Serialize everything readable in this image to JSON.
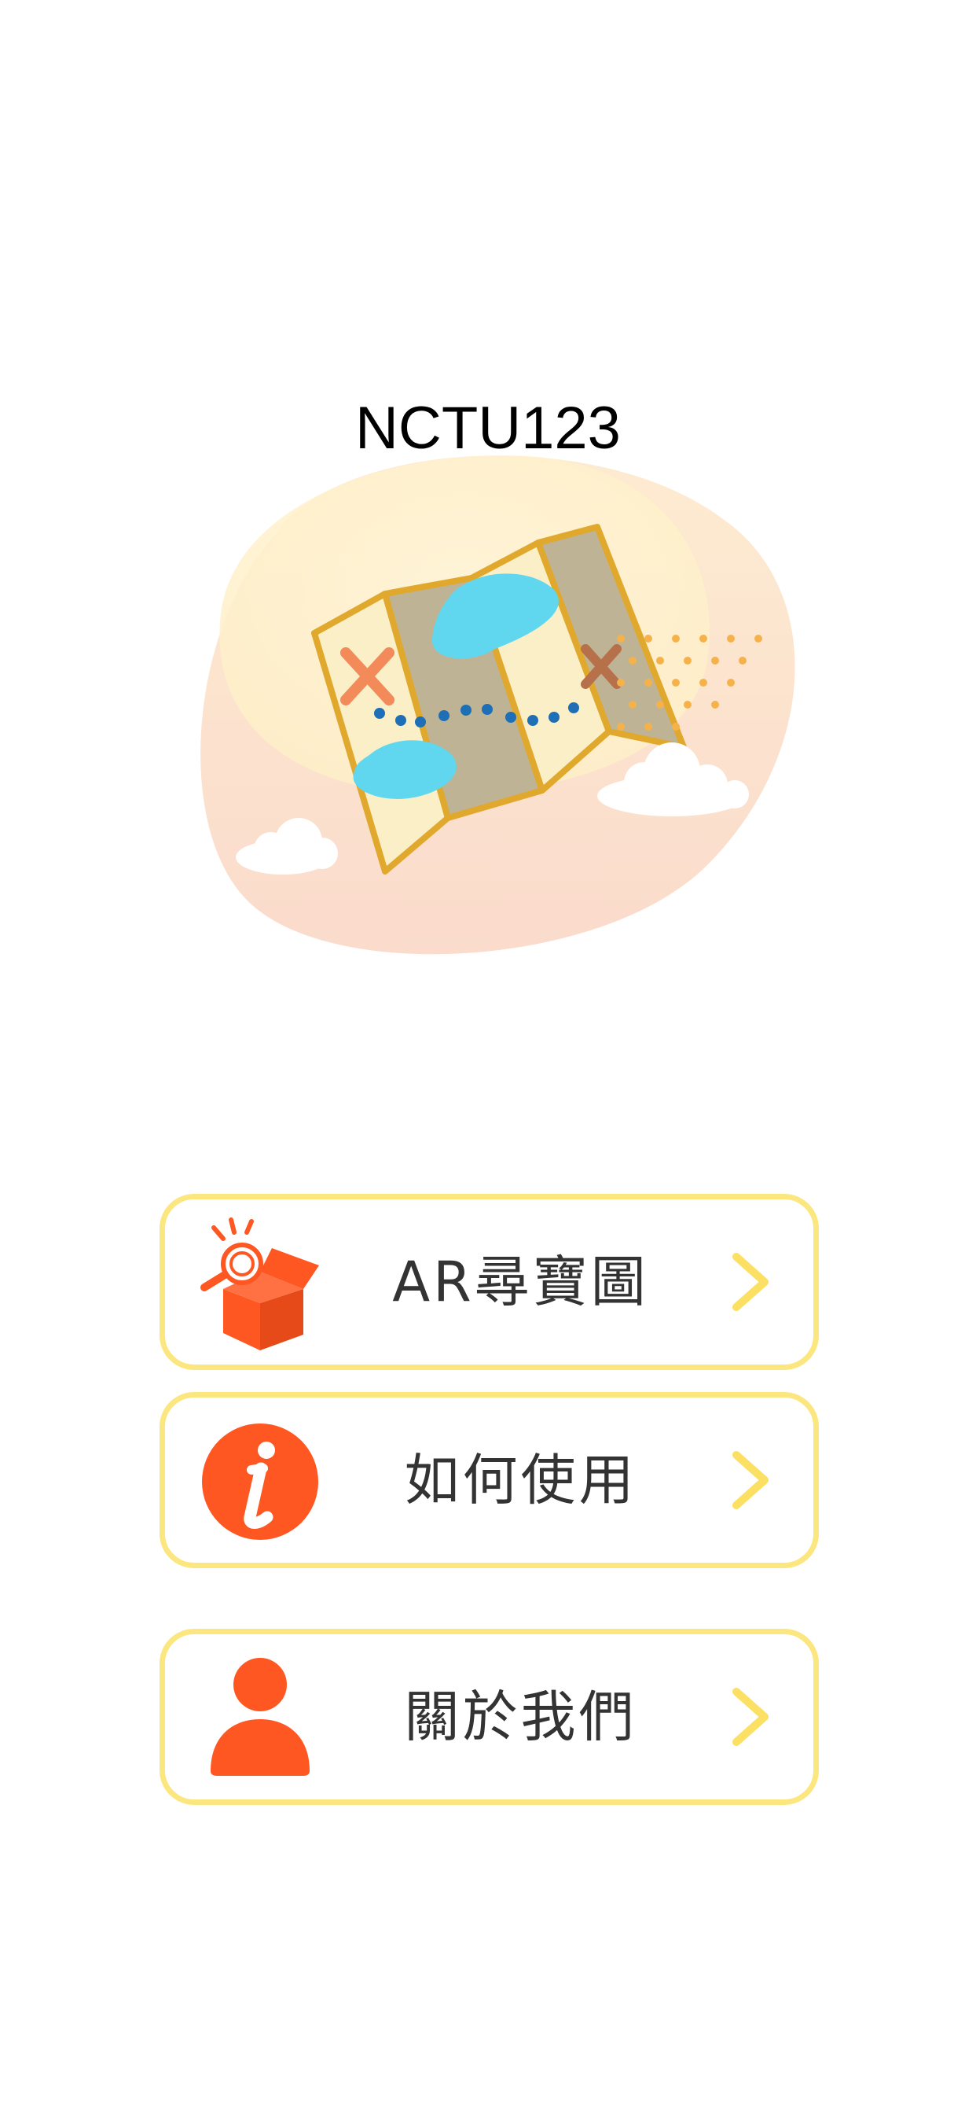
{
  "app": {
    "title": "NCTU123"
  },
  "hero": {
    "icon": "treasure-map-illustration"
  },
  "menu": [
    {
      "label": "AR尋寶圖",
      "icon": "treasure-box-magnifier-icon"
    },
    {
      "label": "如何使用",
      "icon": "info-icon"
    },
    {
      "label": "關於我們",
      "icon": "person-icon"
    }
  ],
  "colors": {
    "accent": "#FF5722",
    "border": "#FCE680",
    "chevron": "#FCE063",
    "text": "#333333"
  }
}
